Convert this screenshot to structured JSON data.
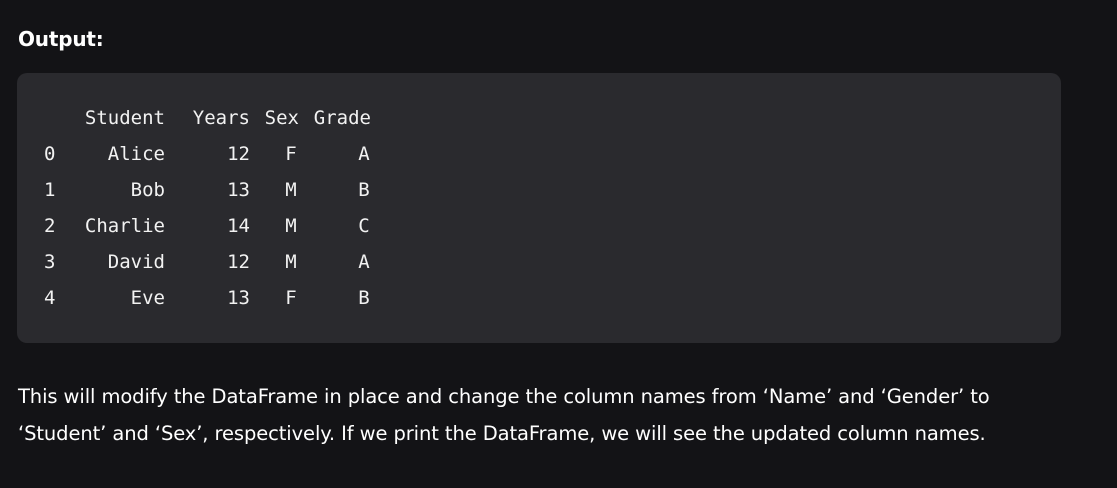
{
  "heading": "Output:",
  "table": {
    "columns": [
      "Student",
      "Years",
      "Sex",
      "Grade"
    ],
    "rows": [
      {
        "index": "0",
        "student": "Alice",
        "years": "12",
        "sex": "F",
        "grade": "A"
      },
      {
        "index": "1",
        "student": "Bob",
        "years": "13",
        "sex": "M",
        "grade": "B"
      },
      {
        "index": "2",
        "student": "Charlie",
        "years": "14",
        "sex": "M",
        "grade": "C"
      },
      {
        "index": "3",
        "student": "David",
        "years": "12",
        "sex": "M",
        "grade": "A"
      },
      {
        "index": "4",
        "student": "Eve",
        "years": "13",
        "sex": "F",
        "grade": "B"
      }
    ]
  },
  "paragraph": "This will modify the DataFrame in place and change the column names from ‘Name’ and ‘Gender’ to ‘Student’ and ‘Sex’, respectively. If we print the DataFrame, we will see the updated column names."
}
